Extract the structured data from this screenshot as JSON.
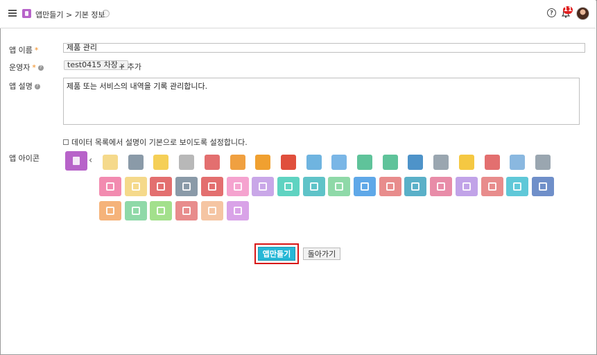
{
  "header": {
    "breadcrumb": "앱만들기 > 기본 정보",
    "info_symbol": "ⓘ",
    "help_symbol": "?",
    "notification_count": "11",
    "icons": [
      "menu-icon",
      "app-icon",
      "info-icon",
      "help-icon",
      "bell-icon",
      "avatar"
    ]
  },
  "form": {
    "app_name_label": "앱 이름",
    "app_name_value": "제품 관리",
    "operator_label": "운영자",
    "operator_tag": "test0415 차장",
    "tag_remove": "×",
    "add_label": "+ 추가",
    "description_label": "앱 설명",
    "description_value": "제품 또는 서비스의 내역을 기록 관리합니다.",
    "show_description_label": "데이터 목록에서 설명이 기본으로 보이도록 설정합니다.",
    "icon_label": "앱 아이콘",
    "required_mark": "*",
    "prev_arrow": "‹"
  },
  "colors": {
    "accent": "#26b7d6",
    "selected_icon": "#b763c9",
    "required": "#f08a1c",
    "badge": "#e02020"
  },
  "icon_rows": [
    [
      "#f5d98b",
      "#8a9aa8",
      "#f5cf57",
      "#b8b8b8",
      "#e36f6f",
      "#f0a040",
      "#f0a030",
      "#e04f3c",
      "#6fb4e0",
      "#7ab6e6",
      "#5fc39a",
      "#5fc39a",
      "#4e93c9",
      "#9aa6b0",
      "#f5c842",
      "#e36f6f",
      "#8ab8e0",
      "#9aa6b0"
    ],
    [
      "#f28bb0",
      "#f5d98b",
      "#e36f6f",
      "#8a9aa8",
      "#e36f6f",
      "#f5a3cf",
      "#c9a7e8",
      "#5fd3c1",
      "#5fc3c8",
      "#8fd9a8",
      "#5fa8e8",
      "#e88c8c",
      "#5ab0c8",
      "#e88ca8",
      "#c1a3e8",
      "#e88c8c",
      "#5fc8d8",
      "#6f8fc9"
    ],
    [
      "#f5b37a",
      "#8fd9a8",
      "#a3e08c",
      "#e88c8c",
      "#f5c5a3",
      "#d9a3e8"
    ]
  ],
  "icon_names": [
    [
      "mail-icon",
      "clock-icon",
      "bulb-icon",
      "microphone-icon",
      "ticket-icon",
      "pie-chart-icon",
      "bar-graph-icon",
      "calendar-24-icon",
      "calendar-26-icon",
      "user-circle-icon",
      "map-icon",
      "chat-icon",
      "credit-card-icon",
      "document-icon",
      "sticky-note-icon",
      "car-icon",
      "gear-icon",
      "presentation-icon"
    ],
    [
      "shopping-bag-icon",
      "folder-icon",
      "clipboard-icon",
      "tablet-icon",
      "monitor-icon",
      "inbox-icon",
      "chart-icon",
      "phone-icon",
      "taxi-icon",
      "group-icon",
      "parking-icon",
      "laptop-icon",
      "tools-icon",
      "lock-icon",
      "calendar-icon",
      "truck-icon",
      "book-icon",
      "bar-chart-icon"
    ],
    [
      "barcode-icon",
      "table-icon",
      "message-icon",
      "contact-card-icon",
      "calculator-icon",
      "document-icon-2"
    ]
  ],
  "buttons": {
    "make": "앱만들기",
    "back": "돌아가기"
  }
}
